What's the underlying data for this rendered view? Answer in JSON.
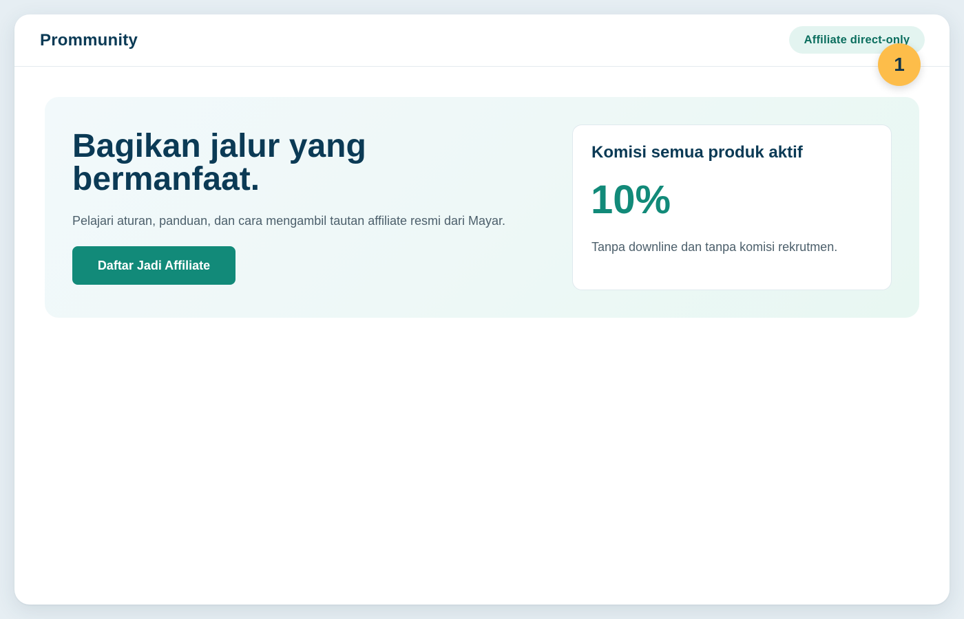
{
  "app": {
    "brand": "Prommunity",
    "mode_pill": "Affiliate direct-only",
    "step_badge": "1"
  },
  "hero": {
    "headline": "Bagikan jalur yang bermanfaat.",
    "subtext": "Pelajari aturan, panduan, dan cara mengambil tautan affiliate resmi dari Mayar.",
    "cta_label": "Daftar Jadi Affiliate"
  },
  "commission_card": {
    "title": "Komisi semua produk aktif",
    "value": "10%",
    "note": "Tanpa downline dan tanpa komisi rekrutmen."
  },
  "colors": {
    "primary": "#128a79",
    "navy": "#0b3a55",
    "badge": "#fdbd4a",
    "pill_bg": "#e3f4f0"
  }
}
